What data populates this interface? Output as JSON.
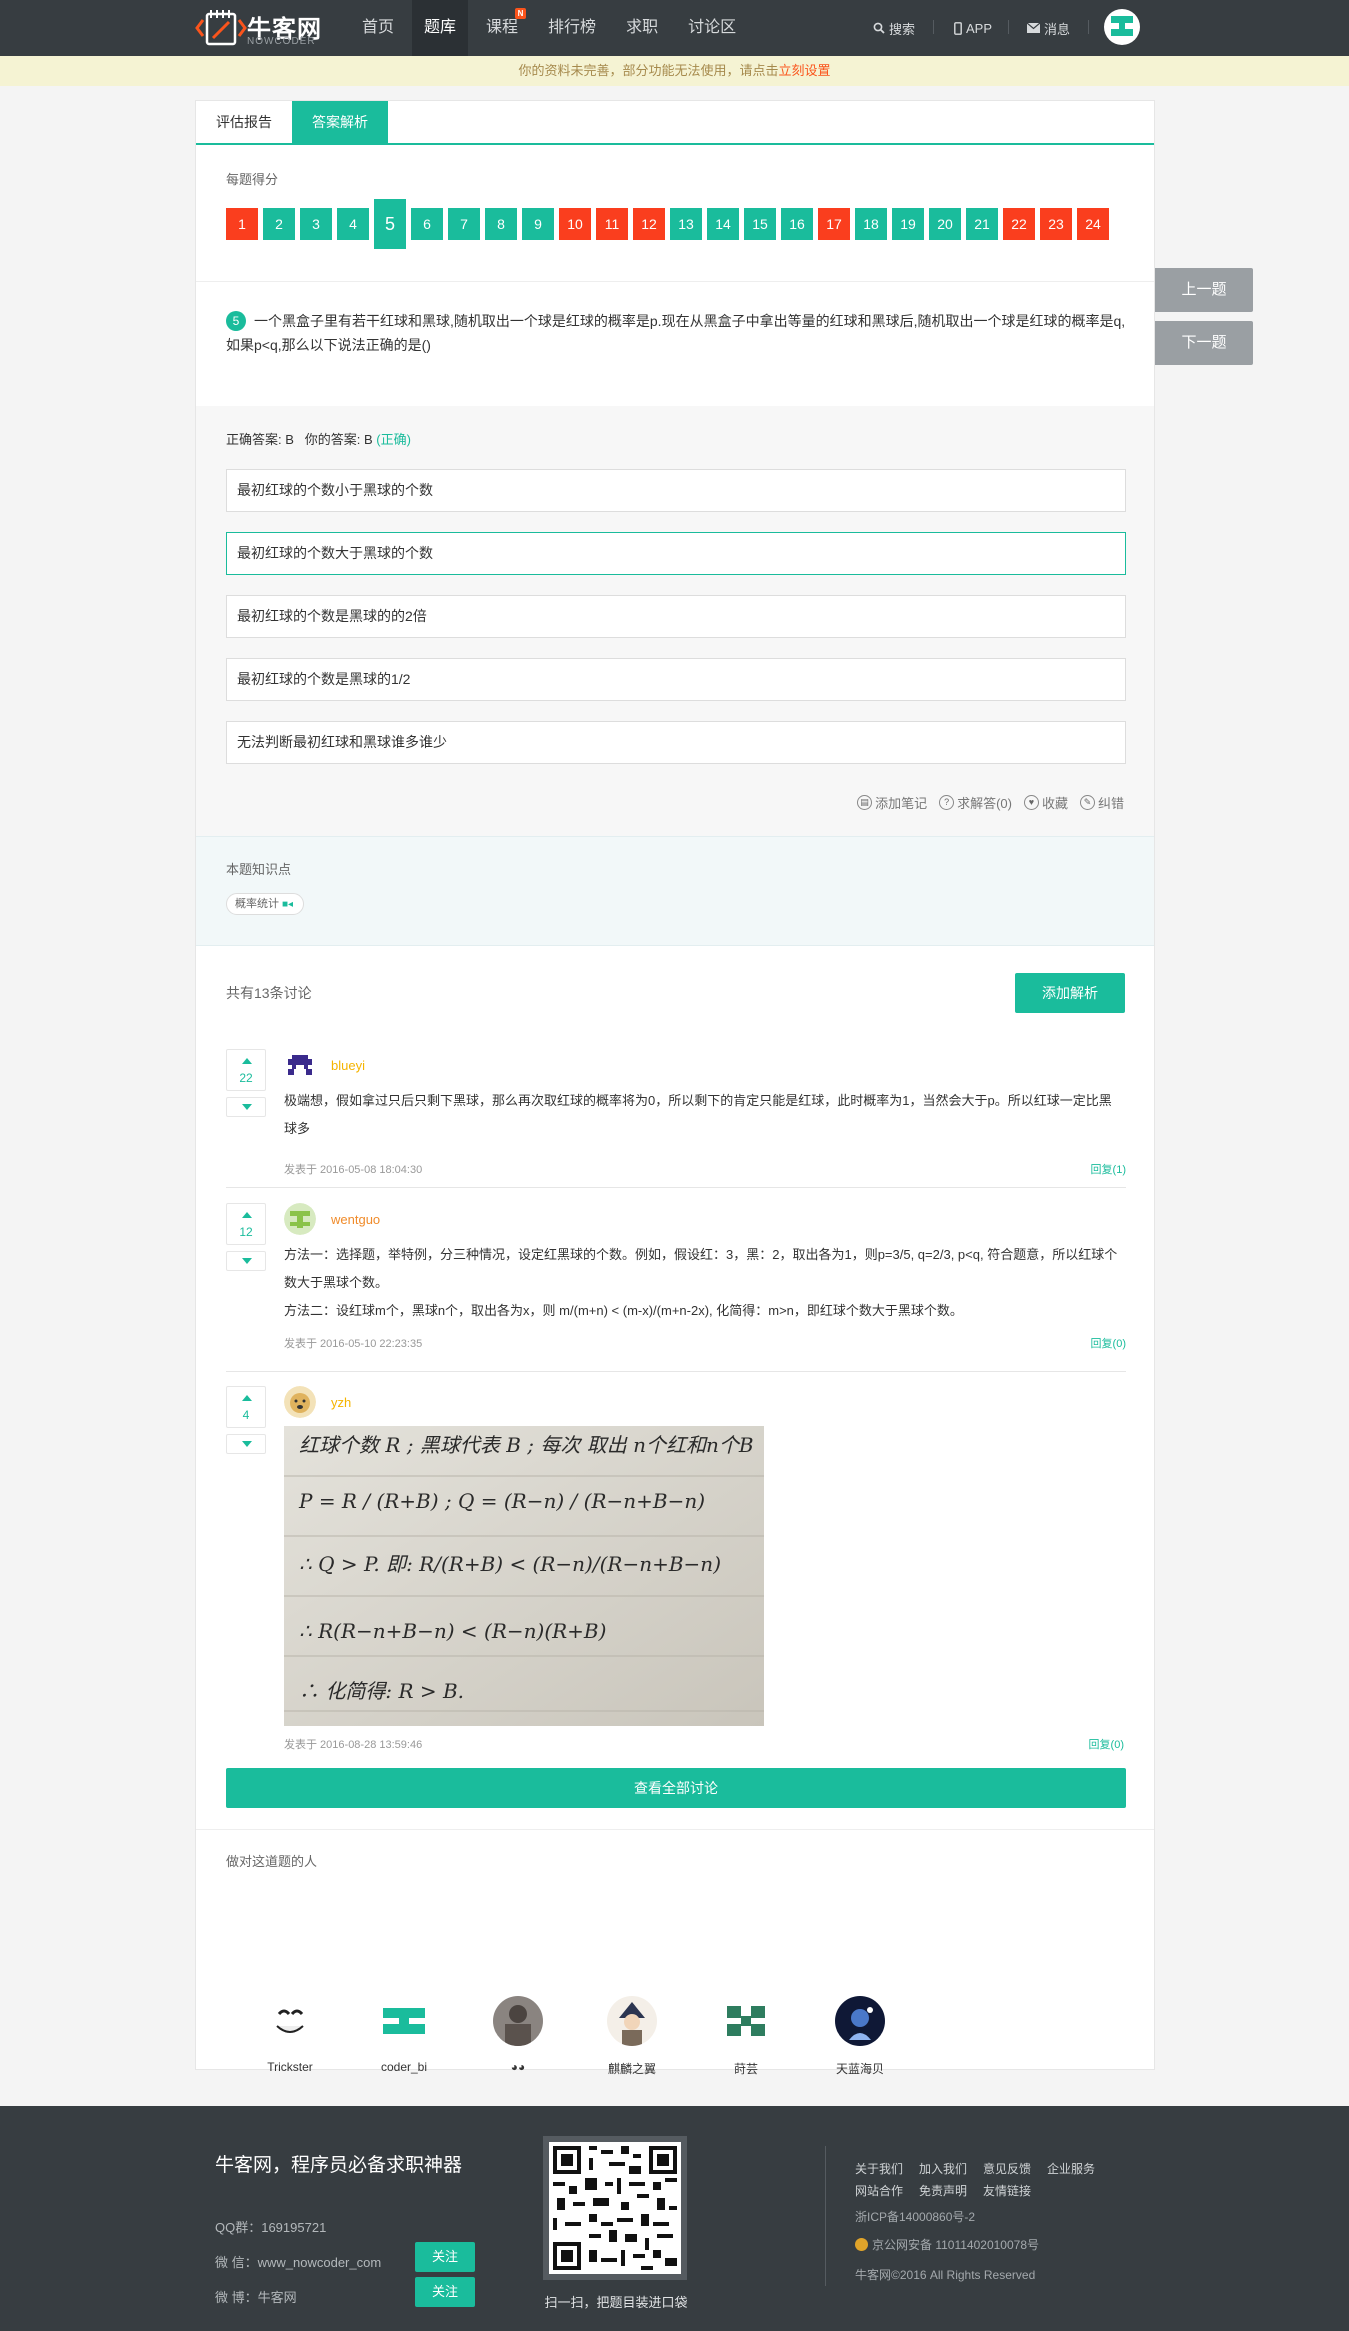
{
  "header": {
    "logo_name": "牛客网",
    "logo_sub": "NOWCODER",
    "nav": [
      {
        "label": "首页"
      },
      {
        "label": "题库"
      },
      {
        "label": "课程",
        "badge": "N"
      },
      {
        "label": "排行榜"
      },
      {
        "label": "求职"
      },
      {
        "label": "讨论区"
      }
    ],
    "search_label": "搜索",
    "app_label": "APP",
    "message_label": "消息"
  },
  "notice": {
    "text": "你的资料未完善，部分功能无法使用，请点击",
    "link": "立刻设置"
  },
  "tabs": [
    "评估报告",
    "答案解析"
  ],
  "score_label": "每题得分",
  "questions": [
    {
      "n": "1",
      "status": "wrong"
    },
    {
      "n": "2",
      "status": "right"
    },
    {
      "n": "3",
      "status": "right"
    },
    {
      "n": "4",
      "status": "right"
    },
    {
      "n": "5",
      "status": "right",
      "current": true
    },
    {
      "n": "6",
      "status": "right"
    },
    {
      "n": "7",
      "status": "right"
    },
    {
      "n": "8",
      "status": "right"
    },
    {
      "n": "9",
      "status": "right"
    },
    {
      "n": "10",
      "status": "wrong"
    },
    {
      "n": "11",
      "status": "wrong"
    },
    {
      "n": "12",
      "status": "wrong"
    },
    {
      "n": "13",
      "status": "right"
    },
    {
      "n": "14",
      "status": "right"
    },
    {
      "n": "15",
      "status": "right"
    },
    {
      "n": "16",
      "status": "right"
    },
    {
      "n": "17",
      "status": "wrong"
    },
    {
      "n": "18",
      "status": "right"
    },
    {
      "n": "19",
      "status": "right"
    },
    {
      "n": "20",
      "status": "right"
    },
    {
      "n": "21",
      "status": "right"
    },
    {
      "n": "22",
      "status": "wrong"
    },
    {
      "n": "23",
      "status": "wrong"
    },
    {
      "n": "24",
      "status": "wrong"
    }
  ],
  "question": {
    "number": "5",
    "text": "一个黑盒子里有若干红球和黑球,随机取出一个球是红球的概率是p.现在从黑盒子中拿出等量的红球和黑球后,随机取出一个球是红球的概率是q,如果p<q,那么以下说法正确的是()"
  },
  "answer": {
    "correct_label": "正确答案: B",
    "yours_label": "你的答案: B",
    "result": "(正确)"
  },
  "options": [
    "最初红球的个数小于黑球的个数",
    "最初红球的个数大于黑球的个数",
    "最初红球的个数是黑球的的2倍",
    "最初红球的个数是黑球的1/2",
    "无法判断最初红球和黑球谁多谁少"
  ],
  "actions": [
    "添加笔记",
    "求解答(0)",
    "收藏",
    "纠错"
  ],
  "knowledge": {
    "title": "本题知识点",
    "tag": "概率统计"
  },
  "discussion": {
    "count_label": "共有13条讨论",
    "add_button": "添加解析",
    "view_all": "查看全部讨论"
  },
  "comments": [
    {
      "user": "blueyi",
      "votes": "22",
      "lines": [
        "极端想，假如拿过只后只剩下黑球，那么再次取红球的概率将为0，所以剩下的肯定只能是红球，此时概率为1，当然会大于p。所以红球一定比黑球多"
      ],
      "time": "发表于 2016-05-08 18:04:30",
      "reply": "回复(1)"
    },
    {
      "user": "wentguo",
      "votes": "12",
      "lines": [
        "方法一：选择题，举特例，分三种情况，设定红黑球的个数。例如，假设红：3，黑：2，取出各为1，则p=3/5, q=2/3, p<q, 符合题意，所以红球个数大于黑球个数。",
        "方法二：设红球m个，黑球n个，取出各为x，则 m/(m+n) < (m-x)/(m+n-2x), 化简得：m>n，即红球个数大于黑球个数。"
      ],
      "time": "发表于 2016-05-10 22:23:35",
      "reply": "回复(0)"
    },
    {
      "user": "yzh",
      "votes": "4",
      "photo_lines": [
        "红球个数 R ; 黑球代表 B ; 每次 取出 n个红和n个B",
        "P = R / (R+B) ;  Q = (R−n) / (R−n+B−n)",
        "∴ Q > P.  即: R/(R+B) < (R−n)/(R−n+B−n)",
        "∴ R(R−n+B−n) < (R−n)(R+B)",
        "∴ 化简得: R > B."
      ],
      "time": "发表于 2016-08-28 13:59:46",
      "reply": "回复(0)"
    }
  ],
  "solvers": {
    "title": "做对这道题的人",
    "people": [
      "Trickster",
      "coder_bi",
      "◕◕",
      "麒麟之翼",
      "莳芸",
      "天蓝海贝"
    ]
  },
  "side_nav": {
    "prev": "上一题",
    "next": "下一题"
  },
  "footer": {
    "slogan": "牛客网，程序员必备求职神器",
    "qq": "QQ群：169195721",
    "wechat": "微 信：www_nowcoder_com",
    "weibo": "微 博：牛客网",
    "follow": "关注",
    "qr_caption": "扫一扫，把题目装进口袋",
    "links_row1": [
      "关于我们",
      "加入我们",
      "意见反馈",
      "企业服务"
    ],
    "links_row2": [
      "网站合作",
      "免责声明",
      "友情链接"
    ],
    "icp": "浙ICP备14000860号-2",
    "police": "京公网安备 11011402010078号",
    "copyright": "牛客网©2016 All Rights Reserved"
  },
  "colors": {
    "brand": "#1abc9c",
    "wrong": "#fa3e1e",
    "header": "#373d41"
  }
}
